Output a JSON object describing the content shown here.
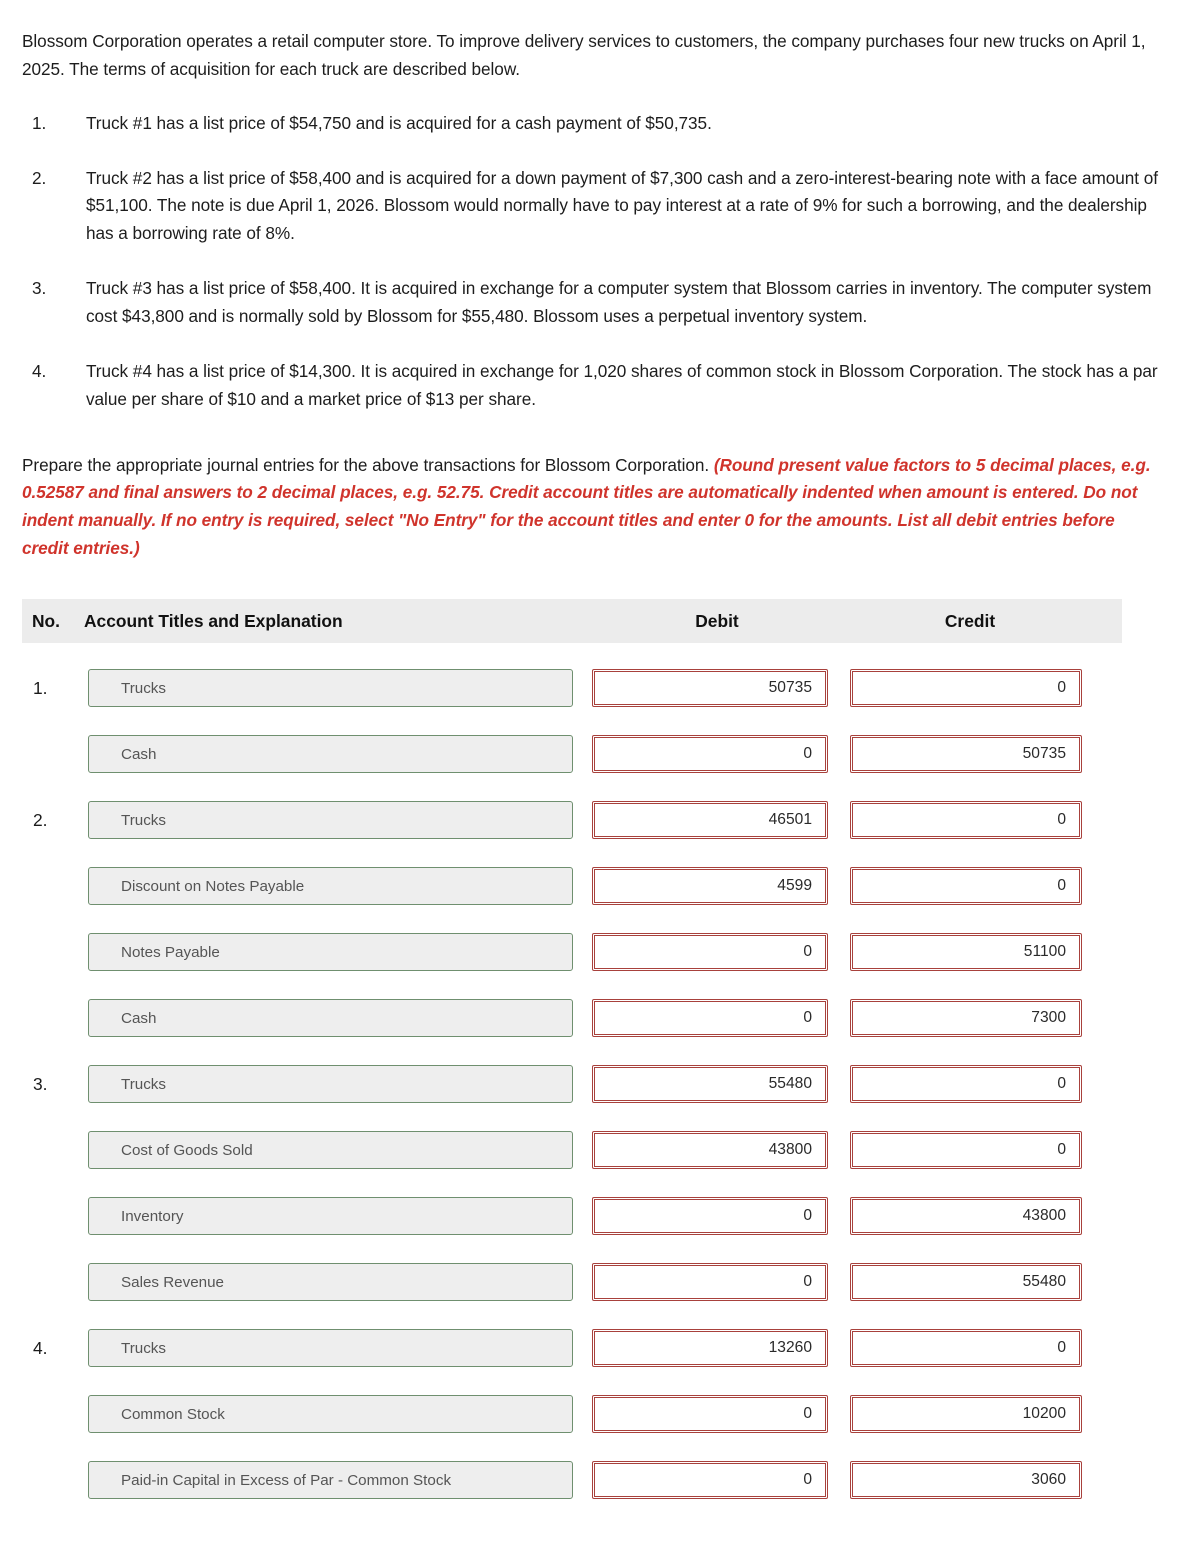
{
  "intro": "Blossom Corporation operates a retail computer store. To improve delivery services to customers, the company purchases four new trucks on April 1, 2025. The terms of acquisition for each truck are described below.",
  "facts": [
    {
      "num": "1.",
      "text": "Truck #1 has a list price of $54,750 and is acquired for a cash payment of $50,735."
    },
    {
      "num": "2.",
      "text": "Truck #2 has a list price of $58,400 and is acquired for a down payment of $7,300 cash and a zero-interest-bearing note with a face amount of $51,100. The note is due April 1, 2026. Blossom would normally have to pay interest at a rate of 9% for such a borrowing, and the dealership has a borrowing rate of 8%."
    },
    {
      "num": "3.",
      "text": "Truck #3 has a list price of $58,400. It is acquired in exchange for a computer system that Blossom carries in inventory. The computer system cost $43,800 and is normally sold by Blossom for $55,480. Blossom uses a perpetual inventory system."
    },
    {
      "num": "4.",
      "text": "Truck #4 has a list price of $14,300. It is acquired in exchange for 1,020 shares of common stock in Blossom Corporation. The stock has a par value per share of $10 and a market price of $13 per share."
    }
  ],
  "instructions": {
    "lead": "Prepare the appropriate journal entries for the above transactions for Blossom Corporation. ",
    "required": "(Round present value factors to 5 decimal places, e.g. 0.52587 and final answers to 2 decimal places, e.g. 52.75. Credit account titles are automatically indented when amount is entered. Do not indent manually. If no entry is required, select \"No Entry\" for the account titles and enter 0 for the amounts. List all debit entries before credit entries.)",
    "required_color": "#d0342c"
  },
  "journal": {
    "headers": {
      "no": "No.",
      "account": "Account Titles and Explanation",
      "debit": "Debit",
      "credit": "Credit"
    },
    "rows": [
      {
        "no": "1.",
        "account": "Trucks",
        "debit": "50735",
        "credit": "0"
      },
      {
        "no": "",
        "account": "Cash",
        "debit": "0",
        "credit": "50735"
      },
      {
        "no": "2.",
        "account": "Trucks",
        "debit": "46501",
        "credit": "0"
      },
      {
        "no": "",
        "account": "Discount on Notes Payable",
        "debit": "4599",
        "credit": "0"
      },
      {
        "no": "",
        "account": "Notes Payable",
        "debit": "0",
        "credit": "51100"
      },
      {
        "no": "",
        "account": "Cash",
        "debit": "0",
        "credit": "7300"
      },
      {
        "no": "3.",
        "account": "Trucks",
        "debit": "55480",
        "credit": "0"
      },
      {
        "no": "",
        "account": "Cost of Goods Sold",
        "debit": "43800",
        "credit": "0"
      },
      {
        "no": "",
        "account": "Inventory",
        "debit": "0",
        "credit": "43800"
      },
      {
        "no": "",
        "account": "Sales Revenue",
        "debit": "0",
        "credit": "55480"
      },
      {
        "no": "4.",
        "account": "Trucks",
        "debit": "13260",
        "credit": "0"
      },
      {
        "no": "",
        "account": "Common Stock",
        "debit": "0",
        "credit": "10200"
      },
      {
        "no": "",
        "account": "Paid-in Capital in Excess of Par - Common Stock",
        "debit": "0",
        "credit": "3060"
      }
    ]
  },
  "colors": {
    "account_border": "#6f8f6f",
    "account_fill": "#eeeeee",
    "money_border": "#a8413c",
    "header_band": "#ececec",
    "required_text": "#d0342c"
  }
}
